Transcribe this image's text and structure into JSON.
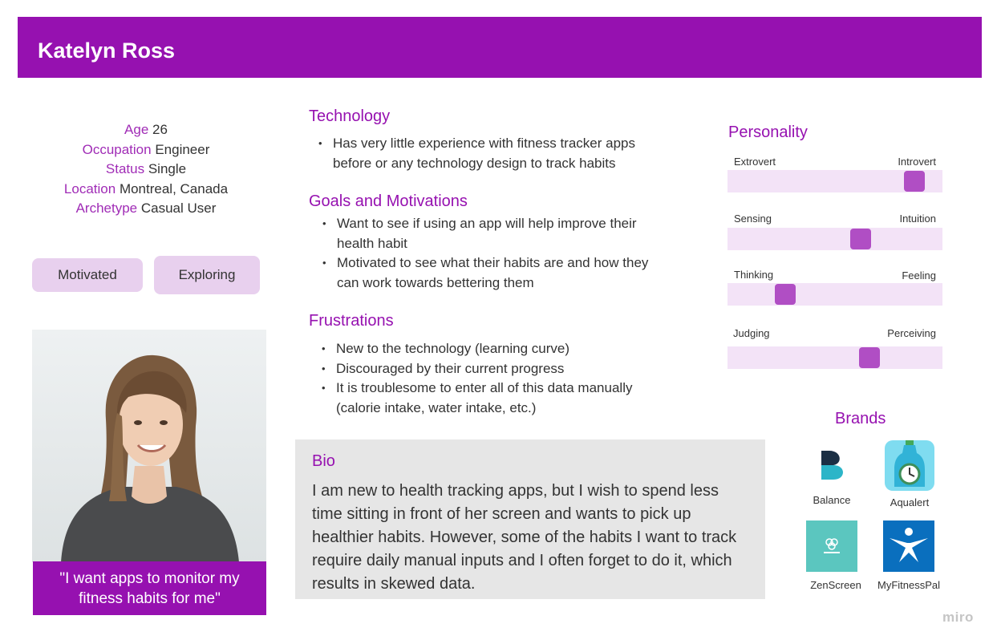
{
  "persona": {
    "name": "Katelyn Ross",
    "demographics": [
      {
        "key": "Age",
        "value": "26"
      },
      {
        "key": "Occupation",
        "value": "Engineer"
      },
      {
        "key": "Status",
        "value": "Single"
      },
      {
        "key": "Location",
        "value": "Montreal, Canada"
      },
      {
        "key": "Archetype",
        "value": "Casual User"
      }
    ],
    "tags": [
      "Motivated",
      "Exploring"
    ],
    "quote": "\"I want apps to monitor my fitness habits for me\""
  },
  "technology": {
    "title": "Technology",
    "items": [
      "Has very little experience with fitness tracker apps before or any technology design to track habits"
    ]
  },
  "goals": {
    "title": "Goals and Motivations",
    "items": [
      "Want to see if using an app will help improve their health habit",
      "Motivated to see what their habits are and how they can work towards bettering them"
    ]
  },
  "frustrations": {
    "title": "Frustrations",
    "items": [
      "New to the technology (learning curve)",
      "Discouraged by their current progress",
      "It is troublesome to enter all of this data manually (calorie intake, water intake, etc.)"
    ]
  },
  "bio": {
    "title": "Bio",
    "text": "I am new to health tracking apps, but I wish to spend less time sitting in front of her screen and wants to pick up healthier habits. However, some of the habits I want to track require daily manual inputs and I often forget to do it, which results in skewed data."
  },
  "personality": {
    "title": "Personality",
    "traits": [
      {
        "left": "Extrovert",
        "right": "Introvert",
        "level": 0.87
      },
      {
        "left": "Sensing",
        "right": "Intuition",
        "level": 0.62
      },
      {
        "left": "Thinking",
        "right": "Feeling",
        "level": 0.27
      },
      {
        "left": "Judging",
        "right": "Perceiving",
        "level": 0.66
      }
    ]
  },
  "brands": {
    "title": "Brands",
    "items": [
      {
        "name": "Balance",
        "icon": "balance-logo-icon"
      },
      {
        "name": "Aqualert",
        "icon": "water-bottle-icon"
      },
      {
        "name": "ZenScreen",
        "icon": "zenscreen-logo-icon"
      },
      {
        "name": "MyFitnessPal",
        "icon": "myfitnesspal-logo-icon"
      }
    ]
  },
  "watermark": "miro",
  "colors": {
    "accent": "#9611b0",
    "accent_text": "#a02cb6",
    "tag_bg": "#e8d0ee",
    "slider_track": "#f3e3f7",
    "slider_thumb": "#b04ec4",
    "bio_bg": "#e6e6e6"
  }
}
